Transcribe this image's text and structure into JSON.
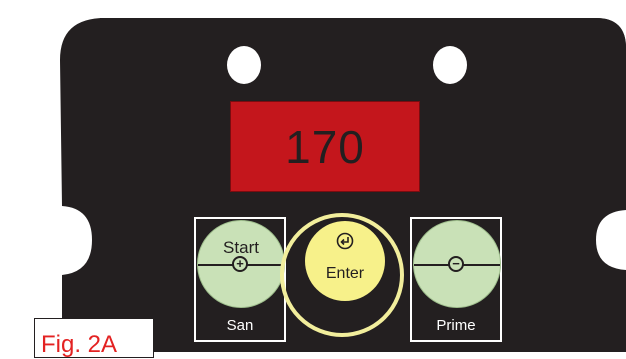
{
  "display": {
    "value": "170"
  },
  "buttons": {
    "start": {
      "top_label": "Start",
      "bottom_label": "San",
      "sign": "+"
    },
    "enter": {
      "label": "Enter"
    },
    "prime": {
      "bottom_label": "Prime",
      "sign": "−"
    }
  },
  "figure": {
    "label": "Fig. 2A"
  },
  "colors": {
    "panel": "#231f20",
    "display_bg": "#c4161c",
    "side_buttons": "#c9e1b7",
    "enter_button": "#f7f18a",
    "enter_ring": "#f2ee9c",
    "figure_label": "#e32222"
  },
  "icons": {
    "enter": "return-arrow-icon"
  }
}
